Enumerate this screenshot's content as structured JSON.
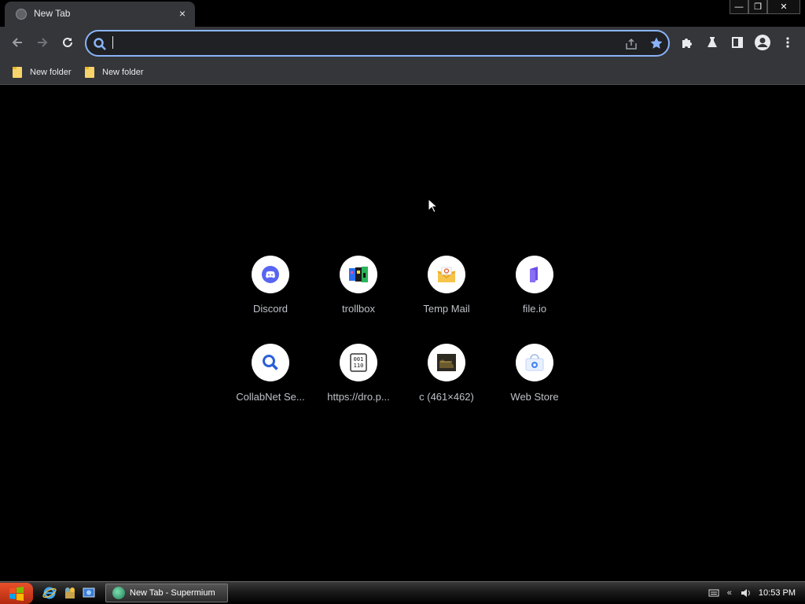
{
  "tab": {
    "title": "New Tab",
    "close_glyph": "×"
  },
  "window_controls": {
    "minimize": "—",
    "maximize": "❐",
    "close": "✕"
  },
  "omnibox": {
    "value": "",
    "placeholder": ""
  },
  "bookmarks": [
    {
      "label": "New folder"
    },
    {
      "label": "New folder"
    }
  ],
  "shortcuts": [
    {
      "label": "Discord",
      "icon": "discord-icon"
    },
    {
      "label": "trollbox",
      "icon": "trollbox-icon"
    },
    {
      "label": "Temp Mail",
      "icon": "mail-icon"
    },
    {
      "label": "file.io",
      "icon": "fileio-icon"
    },
    {
      "label": "CollabNet Se...",
      "icon": "search-icon"
    },
    {
      "label": "https://dro.p...",
      "icon": "binary-icon"
    },
    {
      "label": "c (461×462)",
      "icon": "image-icon"
    },
    {
      "label": "Web Store",
      "icon": "webstore-icon"
    }
  ],
  "taskbar": {
    "task_label": "New Tab - Supermium",
    "tray_chevron": "«",
    "clock": "10:53 PM"
  },
  "colors": {
    "accent": "#8ab4f8",
    "toolbar": "#35363a",
    "background": "#000000"
  }
}
